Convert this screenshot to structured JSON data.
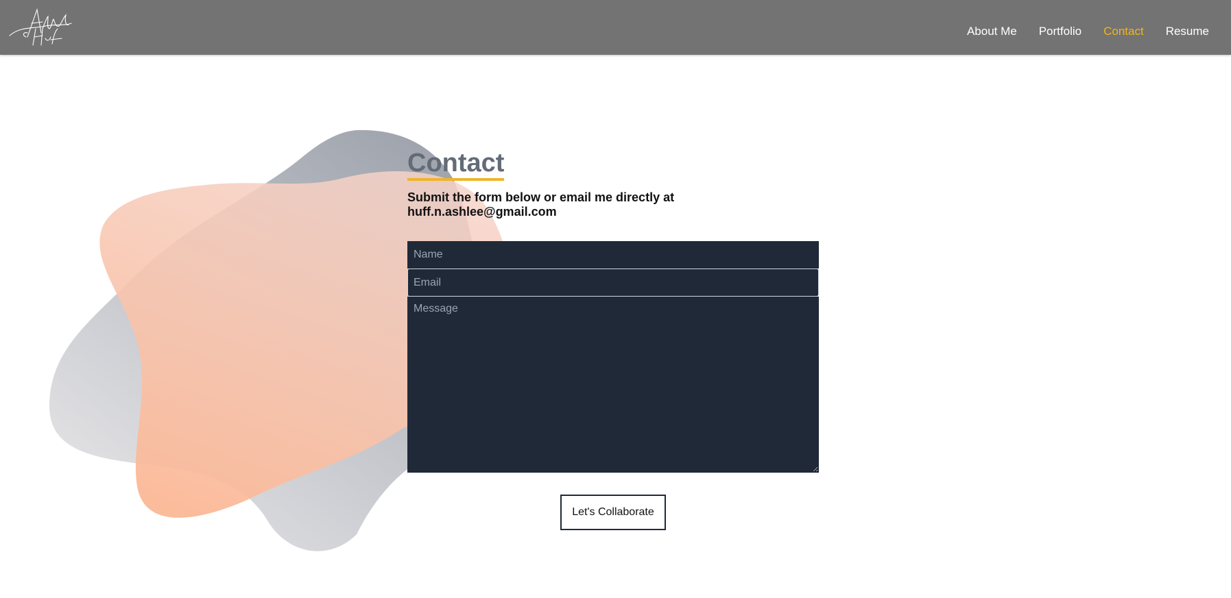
{
  "header": {
    "logo_text": "Ashlee Huff",
    "nav": [
      {
        "label": "About Me",
        "active": false
      },
      {
        "label": "Portfolio",
        "active": false
      },
      {
        "label": "Contact",
        "active": true
      },
      {
        "label": "Resume",
        "active": false
      }
    ]
  },
  "contact": {
    "title": "Contact",
    "subtitle": "Submit the form below or email me directly at huff.n.ashlee@gmail.com"
  },
  "form": {
    "name_placeholder": "Name",
    "email_placeholder": "Email",
    "message_placeholder": "Message",
    "submit_label": "Let's Collaborate"
  },
  "colors": {
    "header_bg": "#737373",
    "active_nav": "#f5b417",
    "field_bg": "#202938",
    "title_color": "#636b77",
    "underline": "#f0b429"
  }
}
